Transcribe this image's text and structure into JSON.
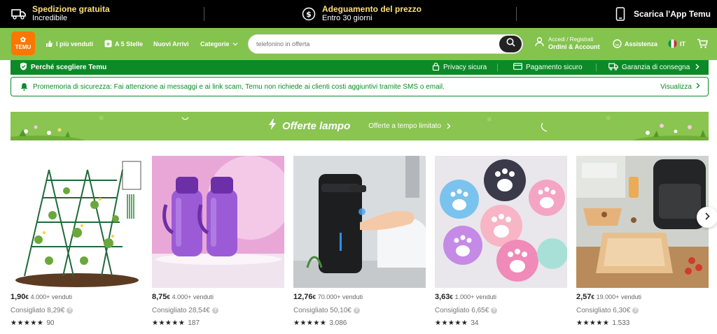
{
  "topbar": {
    "shipping_title": "Spedizione gratuita",
    "shipping_sub": "Incredibile",
    "price_title": "Adeguamento del prezzo",
    "price_sub": "Entro 30 giorni",
    "app_label": "Scarica l'App Temu"
  },
  "nav": {
    "logo_text": "TEMU",
    "best_sellers": "I più venduti",
    "five_stars": "A 5 Stelle",
    "new_arrivals": "Nuovi Arrivi",
    "categories": "Categorie",
    "search_placeholder": "telefonino in offerta",
    "account_line1": "Accedi / Registrati",
    "account_line2": "Ordini & Account",
    "support": "Assistenza",
    "language": "IT"
  },
  "why_bar": {
    "title": "Perché scegliere Temu",
    "privacy": "Privacy sicura",
    "payment": "Pagamento sicuro",
    "delivery": "Garanzia di consegna"
  },
  "security": {
    "message": "Promemoria di sicurezza: Fai attenzione ai messaggi e ai link scam, Temu non richiede ai clienti costi aggiuntivi tramite SMS o email.",
    "link": "Visualizza"
  },
  "banner": {
    "title": "Offerte lampo",
    "subtitle": "Offerte a tempo limitato"
  },
  "products": [
    {
      "price_int": "1,90",
      "currency": "€",
      "sold": "4.000+ venduti",
      "recommended": "Consigliato 8,29€",
      "rating": 4.5,
      "reviews": "90"
    },
    {
      "price_int": "8,75",
      "currency": "€",
      "sold": "4.000+ venduti",
      "recommended": "Consigliato 28,54€",
      "rating": 4.5,
      "reviews": "187"
    },
    {
      "price_int": "12,76",
      "currency": "€",
      "sold": "70.000+ venduti",
      "recommended": "Consigliato 50,10€",
      "rating": 5,
      "reviews": "3.086"
    },
    {
      "price_int": "3,63",
      "currency": "€",
      "sold": "1.000+ venduti",
      "recommended": "Consigliato 6,65€",
      "rating": 4.5,
      "reviews": "34"
    },
    {
      "price_int": "2,57",
      "currency": "€",
      "sold": "19.000+ venduti",
      "recommended": "Consigliato 6,30€",
      "rating": 4.5,
      "reviews": "1.533"
    }
  ],
  "icons": {
    "truck": "truck-icon",
    "dollar": "dollar-icon",
    "phone": "phone-icon",
    "search": "search-icon",
    "user": "user-icon",
    "chat": "chat-icon",
    "flag": "italy-flag-icon",
    "cart": "cart-icon",
    "shield": "shield-icon",
    "lock": "lock-icon",
    "card": "card-icon",
    "delivery": "delivery-truck-icon",
    "bell": "bell-icon",
    "bolt": "bolt-icon",
    "chevron": "chevron-right-icon"
  },
  "colors": {
    "nav_green": "#84c34e",
    "dark_green": "#0d8a28",
    "topbar_black": "#000000",
    "highlight_yellow": "#ffe079",
    "logo_orange": "#fb7701"
  }
}
